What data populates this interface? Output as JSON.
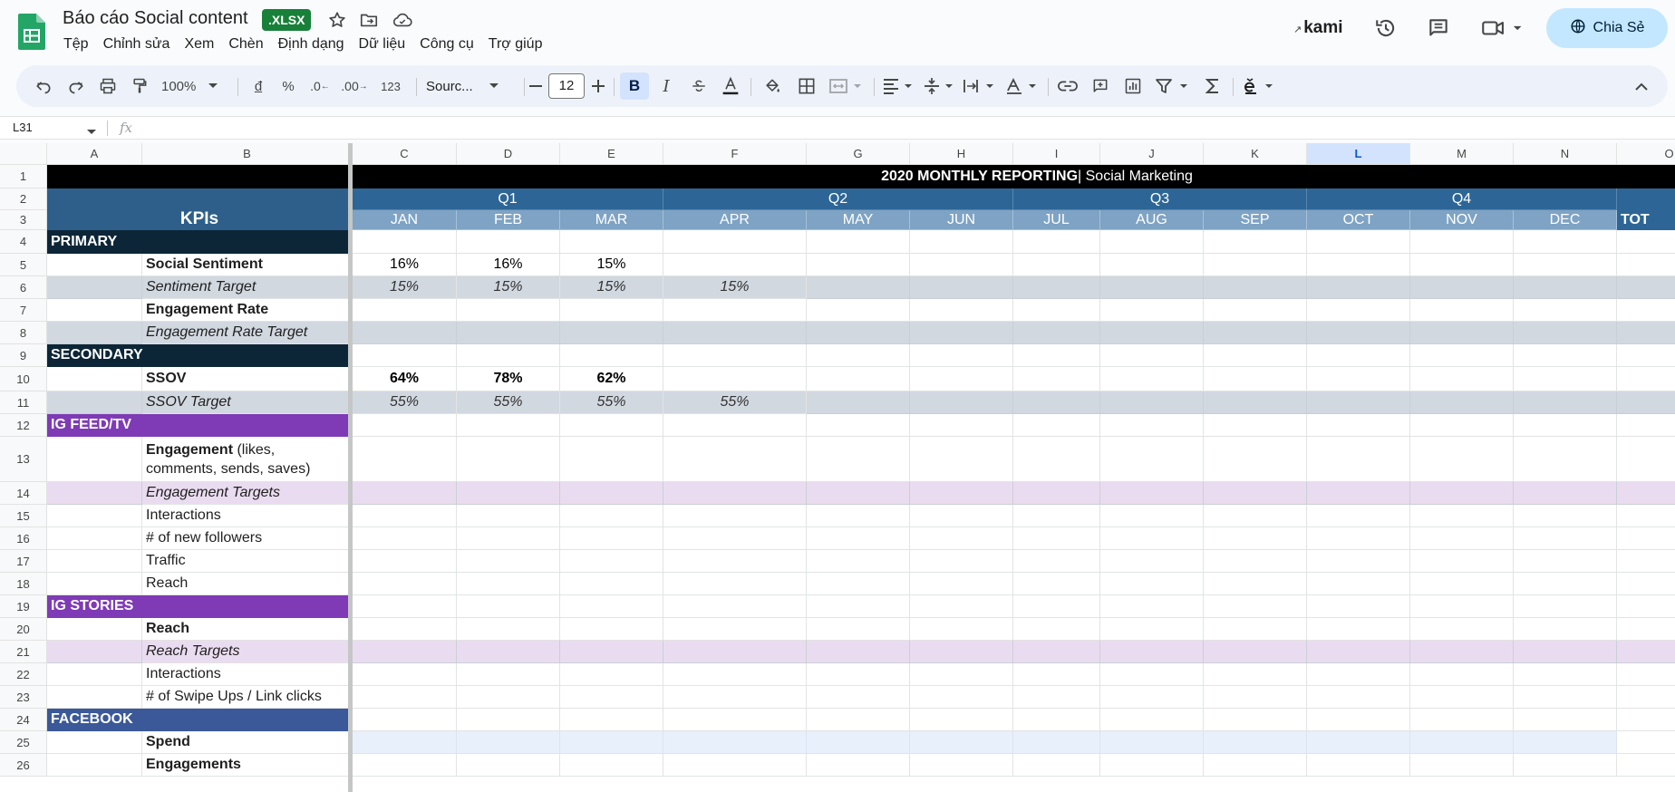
{
  "app": {
    "doc_title": "Báo cáo Social content",
    "file_badge": ".XLSX",
    "menu": [
      "Tệp",
      "Chỉnh sửa",
      "Xem",
      "Chèn",
      "Định dạng",
      "Dữ liệu",
      "Công cụ",
      "Trợ giúp"
    ],
    "kami_label": "kami",
    "share_label": "Chia Sẻ"
  },
  "toolbar": {
    "zoom": "100%",
    "currency": "đ",
    "percent": "%",
    "dec_less": ".0",
    "dec_more": ".00",
    "number_format": "123",
    "font": "Sourc...",
    "font_size": "12",
    "bold": "B",
    "italic": "I"
  },
  "formula_bar": {
    "cell_ref": "L31",
    "fx": "fx"
  },
  "grid": {
    "columns": [
      "A",
      "B",
      "C",
      "D",
      "E",
      "F",
      "G",
      "H",
      "I",
      "J",
      "K",
      "L",
      "M",
      "N",
      "O"
    ],
    "selected_column": "L",
    "rows": [
      "1",
      "2",
      "3",
      "4",
      "5",
      "6",
      "7",
      "8",
      "9",
      "10",
      "11",
      "12",
      "13",
      "14",
      "15",
      "16",
      "17",
      "18",
      "19",
      "20",
      "21",
      "22",
      "23",
      "24",
      "25",
      "26"
    ],
    "title_bold": "2020 MONTHLY REPORTING",
    "title_rest": " | Social Marketing",
    "kpis_label": "KPIs",
    "quarters": [
      "Q1",
      "Q2",
      "Q3",
      "Q4"
    ],
    "months": [
      "JAN",
      "FEB",
      "MAR",
      "APR",
      "MAY",
      "JUN",
      "JUL",
      "AUG",
      "SEP",
      "OCT",
      "NOV",
      "DEC"
    ],
    "total_label": "TOT",
    "sections": {
      "primary": "PRIMARY",
      "secondary": "SECONDARY",
      "ig_feed": "IG FEED/TV",
      "ig_stories": "IG STORIES",
      "facebook": "FACEBOOK"
    },
    "labels": {
      "social_sentiment": "Social Sentiment",
      "sentiment_target": "Sentiment Target",
      "engagement_rate": "Engagement Rate",
      "engagement_rate_target": "Engagement Rate Target",
      "ssov": "SSOV",
      "ssov_target": "SSOV Target",
      "engagement_bold": "Engagement",
      "engagement_rest": " (likes, comments, sends, saves)",
      "engagement_targets": "Engagement Targets",
      "interactions": "Interactions",
      "new_followers": "# of new followers",
      "traffic": "Traffic",
      "reach": "Reach",
      "stories_reach": "Reach",
      "reach_targets": "Reach Targets",
      "stories_interactions": "Interactions",
      "swipe_ups": "# of Swipe Ups / Link clicks",
      "spend": "Spend",
      "engagements": "Engagements"
    },
    "values": {
      "social_sentiment": [
        "16%",
        "16%",
        "15%"
      ],
      "sentiment_target": [
        "15%",
        "15%",
        "15%",
        "15%"
      ],
      "ssov": [
        "64%",
        "78%",
        "62%"
      ],
      "ssov_target": [
        "55%",
        "55%",
        "55%",
        "55%"
      ]
    }
  },
  "colors": {
    "black": "#000000",
    "kpi_blue": "#2e5f8a",
    "quarter_blue": "#2d6696",
    "month_blue": "#7ea3c4",
    "primary_navy": "#0c2637",
    "target_gray": "#d1d8e0",
    "purple": "#7e3bb5",
    "light_purple": "#eadcf0",
    "facebook_blue": "#3b5998",
    "light_blue": "#e8f0fb",
    "sheets_green": "#188038"
  }
}
